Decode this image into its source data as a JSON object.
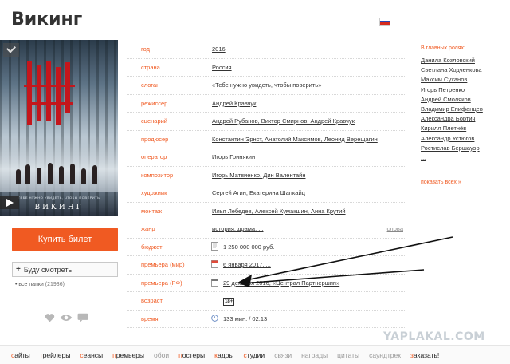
{
  "title": "Викинг",
  "flag": {
    "colors": [
      "#ffffff",
      "#2a47b3",
      "#d52b1e"
    ]
  },
  "poster": {
    "tagline": "ТЕБЕ НУЖНО УВИДЕТЬ, ЧТОБЫ ПОВЕРИТЬ",
    "name": "ВИКИНГ"
  },
  "buy_button": "Купить билет",
  "watch_select": {
    "plus": "+",
    "label": "Буду смотреть"
  },
  "folders": {
    "label": "все папки",
    "count": "(21936)"
  },
  "info": [
    {
      "label": "год",
      "value": "2016"
    },
    {
      "label": "страна",
      "value": "Россия"
    },
    {
      "label": "слоган",
      "value": "«Тебе нужно увидеть, чтобы поверить»"
    },
    {
      "label": "режиссер",
      "value": "Андрей Кравчук"
    },
    {
      "label": "сценарий",
      "value": "Андрей Рубанов, Виктор Смирнов, Андрей Кравчук"
    },
    {
      "label": "продюсер",
      "value": "Константин Эрнст, Анатолий Максимов, Леонид Верещагин"
    },
    {
      "label": "оператор",
      "value": "Игорь Гринякин"
    },
    {
      "label": "композитор",
      "value": "Игорь Матвиенко, Дин Валентайн"
    },
    {
      "label": "художник",
      "value": "Сергей Агин, Екатерина Шапкайц"
    },
    {
      "label": "монтаж",
      "value": "Илья Лебедев, Алексей Кумакшин, Анна Крутий"
    },
    {
      "label": "жанр",
      "value": "история, драма, ...",
      "more": "слова"
    },
    {
      "label": "бюджет",
      "value": "1 250 000 000 руб."
    },
    {
      "label": "премьера (мир)",
      "value": "6 января 2017, ..."
    },
    {
      "label": "премьера (РФ)",
      "value": "29 декабря 2016, «Централ Партнершип»"
    },
    {
      "label": "возраст",
      "value": "18+"
    },
    {
      "label": "время",
      "value": "133 мин. / 02:13"
    }
  ],
  "cast": {
    "heading": "В главных ролях:",
    "actors": [
      "Данила Козловский",
      "Светлана Ходченкова",
      "Максим Суханов",
      "Игорь Петренко",
      "Андрей Смоляков",
      "Владимир Епифанцев",
      "Александра Бортич",
      "Кирилл Плетнёв",
      "Александр Устюгов",
      "Ростислав Бершауэр",
      "..."
    ],
    "show_all": "показать всех »"
  },
  "watermark": "YAPLAKAL.COM",
  "bottom_nav": [
    {
      "first": "с",
      "rest": "айты",
      "active": true
    },
    {
      "first": "т",
      "rest": "рейлеры",
      "active": true
    },
    {
      "first": "с",
      "rest": "еансы",
      "active": true
    },
    {
      "first": "п",
      "rest": "ремьеры",
      "active": true
    },
    {
      "first": "",
      "rest": "обои",
      "active": false
    },
    {
      "first": "п",
      "rest": "остеры",
      "active": true
    },
    {
      "first": "к",
      "rest": "адры",
      "active": true
    },
    {
      "first": "с",
      "rest": "тудии",
      "active": true
    },
    {
      "first": "",
      "rest": "связи",
      "active": false
    },
    {
      "first": "",
      "rest": "награды",
      "active": false
    },
    {
      "first": "",
      "rest": "цитаты",
      "active": false
    },
    {
      "first": "",
      "rest": "саундтрек",
      "active": false
    },
    {
      "first": "з",
      "rest": "аказать!",
      "active": true
    }
  ],
  "colors": {
    "accent": "#f05a22",
    "link": "#333333",
    "muted": "#999999"
  }
}
